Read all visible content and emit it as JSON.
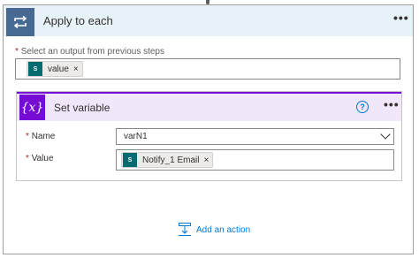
{
  "header": {
    "title": "Apply to each",
    "more_label": "•••"
  },
  "output_field": {
    "required_star": "*",
    "label": "Select an output from previous steps",
    "token": {
      "icon_text": "S",
      "label": "value",
      "remove": "×"
    }
  },
  "set_variable": {
    "title": "Set variable",
    "help": "?",
    "more_label": "•••",
    "name_label": "Name",
    "name_value": "varN1",
    "value_label": "Value",
    "required_star": "*",
    "value_token": {
      "icon_text": "S",
      "label": "Notify_1 Email",
      "remove": "×"
    }
  },
  "add_action": {
    "label": "Add an action"
  },
  "colors": {
    "header_bg": "#e6f2f8",
    "loop_icon": "#486991",
    "variable_accent": "#770bd6",
    "sharepoint": "#036c70",
    "link": "#0078d4"
  }
}
